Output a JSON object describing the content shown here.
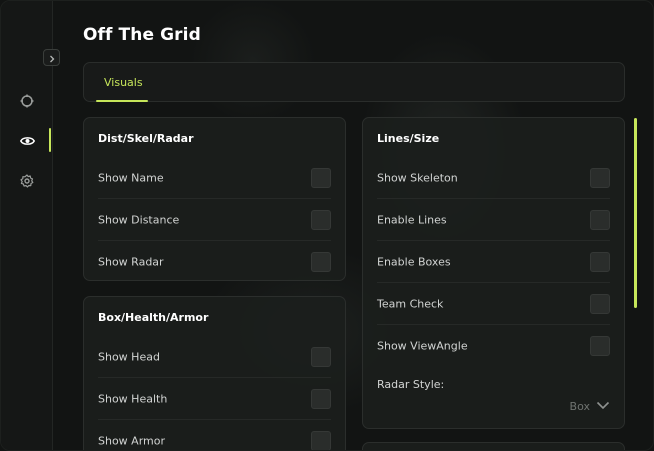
{
  "app": {
    "title": "Off The Grid"
  },
  "sidebar": {
    "items": [
      {
        "icon": "crosshair-icon",
        "active": false
      },
      {
        "icon": "eye-icon",
        "active": true
      },
      {
        "icon": "gear-icon",
        "active": false
      }
    ],
    "collapse_icon": "chevron-right-icon"
  },
  "tabs": [
    {
      "label": "Visuals",
      "active": true
    }
  ],
  "sections": {
    "dist": {
      "title": "Dist/Skel/Radar",
      "options": [
        {
          "label": "Show Name",
          "checked": false
        },
        {
          "label": "Show Distance",
          "checked": false
        },
        {
          "label": "Show Radar",
          "checked": false
        }
      ]
    },
    "box": {
      "title": "Box/Health/Armor",
      "options": [
        {
          "label": "Show Head",
          "checked": false
        },
        {
          "label": "Show Health",
          "checked": false
        },
        {
          "label": "Show Armor",
          "checked": false
        }
      ]
    },
    "lines": {
      "title": "Lines/Size",
      "options": [
        {
          "label": "Show Skeleton",
          "checked": false
        },
        {
          "label": "Enable Lines",
          "checked": false
        },
        {
          "label": "Enable Boxes",
          "checked": false
        },
        {
          "label": "Team Check",
          "checked": false
        },
        {
          "label": "Show ViewAngle",
          "checked": false
        }
      ],
      "radar_style": {
        "label": "Radar Style:",
        "value": "Box"
      }
    }
  },
  "colors": {
    "accent": "#c6e65a",
    "background": "#121413",
    "card": "#1b1e1c",
    "checkbox": "#2a2d2b"
  }
}
